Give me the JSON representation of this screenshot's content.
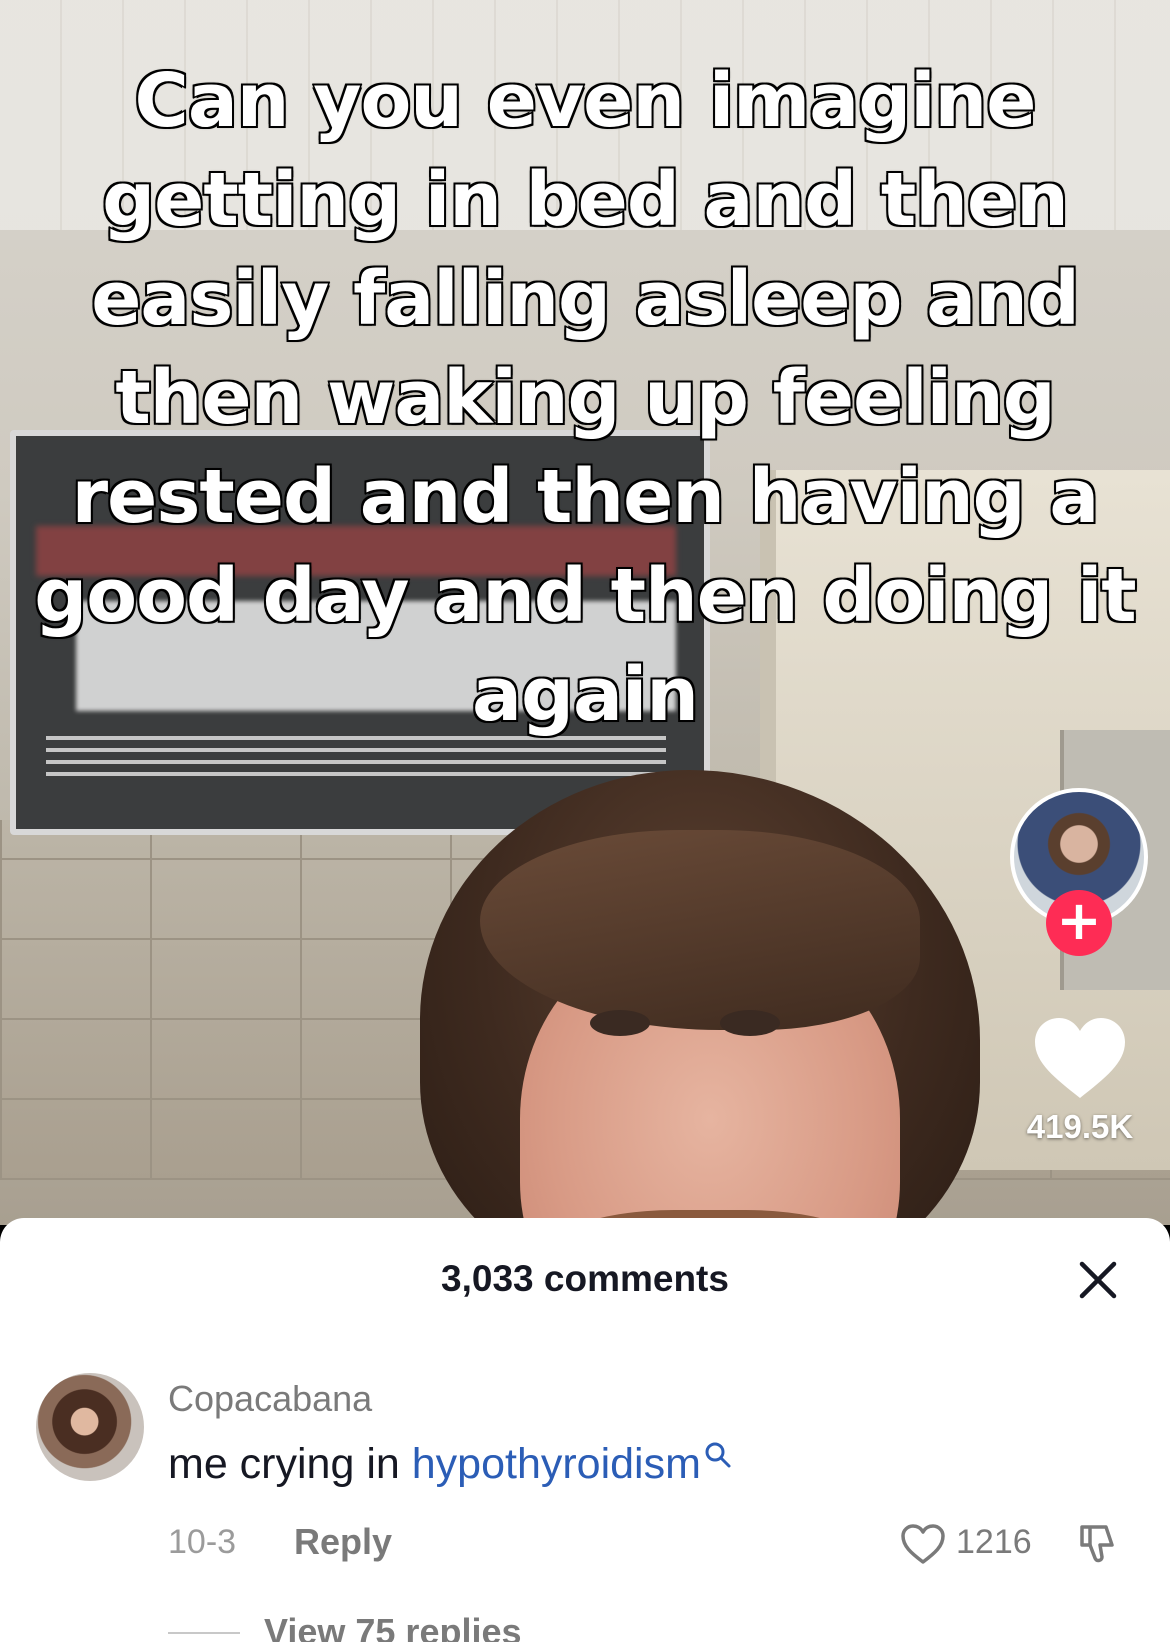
{
  "video": {
    "caption": "Can you even imagine getting in bed and then easily falling asleep and then waking up feeling rested and then having a good day and then doing it again",
    "like_count": "419.5K"
  },
  "comments": {
    "header": "3,033 comments",
    "items": [
      {
        "username": "Copacabana",
        "text_prefix": "me crying in ",
        "link_text": "hypothyroidism",
        "date": "10-3",
        "reply_label": "Reply",
        "likes": "1216",
        "view_replies": "View 75 replies"
      }
    ]
  },
  "colors": {
    "follow_accent": "#fe2c55",
    "link_blue": "#2b5db6",
    "sheet_bg": "#ffffff"
  },
  "icons": [
    "follow-plus-icon",
    "heart-icon",
    "close-icon",
    "search-icon",
    "heart-outline-icon",
    "dislike-icon"
  ]
}
